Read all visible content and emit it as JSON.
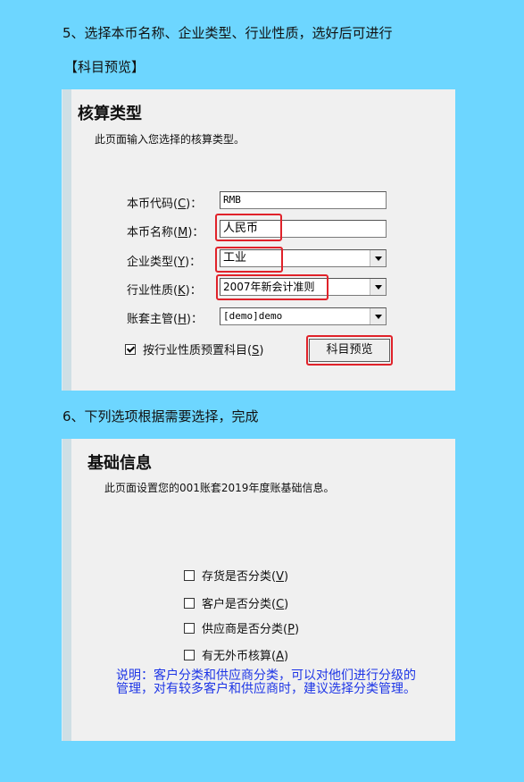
{
  "step5": {
    "text": "5、选择本币名称、企业类型、行业性质，选好后可进行",
    "button_ref": "【科目预览】"
  },
  "panel1": {
    "title": "核算类型",
    "subtitle": "此页面输入您选择的核算类型。",
    "fields": [
      {
        "label": "本币代码",
        "key": "C",
        "value": "RMB",
        "type": "text"
      },
      {
        "label": "本币名称",
        "key": "M",
        "value": "人民币",
        "type": "text"
      },
      {
        "label": "企业类型",
        "key": "Y",
        "value": "工业",
        "type": "combo"
      },
      {
        "label": "行业性质",
        "key": "K",
        "value": "2007年新会计准则",
        "type": "combo"
      },
      {
        "label": "账套主管",
        "key": "H",
        "value": "[demo]demo",
        "type": "combo"
      }
    ],
    "checkbox": {
      "label": "按行业性质预置科目",
      "key": "S",
      "checked": true
    },
    "preview_button": "科目预览"
  },
  "step6": {
    "text": "6、下列选项根据需要选择，完成"
  },
  "panel2": {
    "title": "基础信息",
    "subtitle": "此页面设置您的001账套2019年度账基础信息。",
    "checkboxes": [
      {
        "label": "存货是否分类",
        "key": "V",
        "checked": false
      },
      {
        "label": "客户是否分类",
        "key": "C",
        "checked": false
      },
      {
        "label": "供应商是否分类",
        "key": "P",
        "checked": false
      },
      {
        "label": "有无外币核算",
        "key": "A",
        "checked": false
      }
    ],
    "note": "说明：客户分类和供应商分类，可以对他们进行分级的管理，对有较多客户和供应商时，建议选择分类管理。"
  },
  "colors": {
    "page_bg": "#6dd6ff",
    "panel_bg": "#f0f0f0",
    "highlight": "#e0222a",
    "note_text": "#1d35e6"
  }
}
